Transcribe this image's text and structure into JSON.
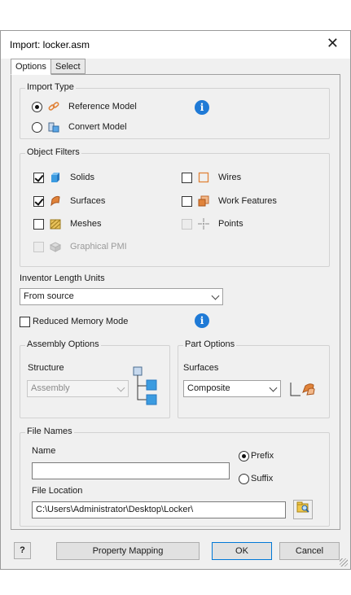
{
  "window": {
    "title": "Import: locker.asm",
    "close_glyph": "✕"
  },
  "tabs": [
    {
      "label": "Options",
      "active": true
    },
    {
      "label": "Select",
      "active": false
    }
  ],
  "import_type": {
    "legend": "Import Type",
    "options": [
      {
        "label": "Reference Model",
        "selected": true,
        "icon": "link-icon"
      },
      {
        "label": "Convert Model",
        "selected": false,
        "icon": "convert-model-icon"
      }
    ],
    "info_glyph": "i"
  },
  "object_filters": {
    "legend": "Object Filters",
    "items": [
      {
        "label": "Solids",
        "checked": true,
        "enabled": true,
        "icon": "solid-cube-icon"
      },
      {
        "label": "Surfaces",
        "checked": true,
        "enabled": true,
        "icon": "surface-icon"
      },
      {
        "label": "Meshes",
        "checked": false,
        "enabled": true,
        "icon": "mesh-icon"
      },
      {
        "label": "Graphical PMI",
        "checked": false,
        "enabled": false,
        "icon": "pmi-icon"
      },
      {
        "label": "Wires",
        "checked": false,
        "enabled": true,
        "icon": "wire-icon"
      },
      {
        "label": "Work Features",
        "checked": false,
        "enabled": true,
        "icon": "work-features-icon"
      },
      {
        "label": "Points",
        "checked": false,
        "enabled": false,
        "icon": "point-icon"
      }
    ]
  },
  "units": {
    "label": "Inventor Length Units",
    "value": "From source"
  },
  "reduced_memory": {
    "label": "Reduced Memory Mode",
    "checked": false,
    "info_glyph": "i"
  },
  "assembly_options": {
    "legend": "Assembly Options",
    "structure_label": "Structure",
    "structure_value": "Assembly",
    "enabled": false
  },
  "part_options": {
    "legend": "Part Options",
    "surfaces_label": "Surfaces",
    "surfaces_value": "Composite"
  },
  "file_names": {
    "legend": "File Names",
    "name_label": "Name",
    "name_value": "",
    "prefix_label": "Prefix",
    "suffix_label": "Suffix",
    "prefix_selected": true,
    "location_label": "File Location",
    "location_value": "C:\\Users\\Administrator\\Desktop\\Locker\\"
  },
  "footer": {
    "help_glyph": "?",
    "property_mapping": "Property Mapping",
    "ok": "OK",
    "cancel": "Cancel"
  },
  "colors": {
    "accent": "#0078d7",
    "info_blue": "#1f7ad6",
    "solid_blue": "#3b9be0",
    "surface_orange": "#e0833a"
  }
}
